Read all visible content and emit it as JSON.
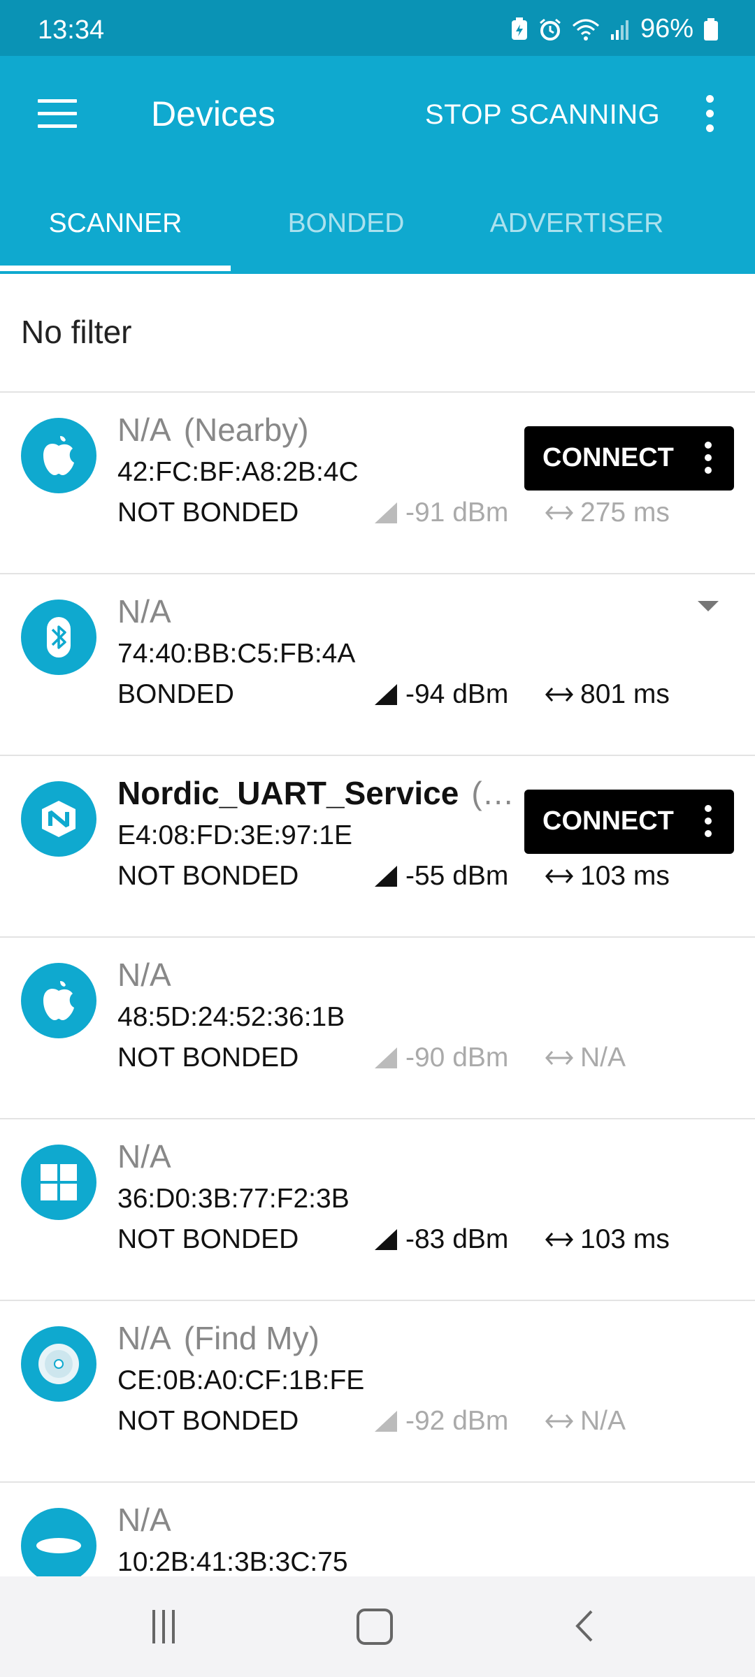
{
  "status_bar": {
    "time": "13:34",
    "battery": "96%"
  },
  "app_bar": {
    "title": "Devices",
    "stop_scanning": "STOP SCANNING"
  },
  "tabs": [
    "SCANNER",
    "BONDED",
    "ADVERTISER"
  ],
  "filter": {
    "label": "No filter"
  },
  "connect_label": "CONNECT",
  "devices": [
    {
      "name": "N/A",
      "suffix": "(Nearby)",
      "address": "42:FC:BF:A8:2B:4C",
      "bond": "NOT BONDED",
      "rssi": "-91 dBm",
      "interval": "275 ms",
      "icon": "apple-icon"
    },
    {
      "name": "N/A",
      "suffix": "",
      "address": "74:40:BB:C5:FB:4A",
      "bond": "BONDED",
      "rssi": "-94 dBm",
      "interval": "801 ms",
      "icon": "bluetooth-icon"
    },
    {
      "name": "Nordic_UART_Service",
      "suffix": "(…",
      "address": "E4:08:FD:3E:97:1E",
      "bond": "NOT BONDED",
      "rssi": "-55 dBm",
      "interval": "103 ms",
      "icon": "nordic-icon"
    },
    {
      "name": "N/A",
      "suffix": "",
      "address": "48:5D:24:52:36:1B",
      "bond": "NOT BONDED",
      "rssi": "-90 dBm",
      "interval": "N/A",
      "icon": "apple-icon"
    },
    {
      "name": "N/A",
      "suffix": "",
      "address": "36:D0:3B:77:F2:3B",
      "bond": "NOT BONDED",
      "rssi": "-83 dBm",
      "interval": "103 ms",
      "icon": "windows-icon"
    },
    {
      "name": "N/A",
      "suffix": "(Find My)",
      "address": "CE:0B:A0:CF:1B:FE",
      "bond": "NOT BONDED",
      "rssi": "-92 dBm",
      "interval": "N/A",
      "icon": "findmy-icon"
    },
    {
      "name": "N/A",
      "suffix": "",
      "address": "10:2B:41:3B:3C:75",
      "bond": "",
      "rssi": "",
      "interval": "",
      "icon": "samsung-icon"
    }
  ]
}
